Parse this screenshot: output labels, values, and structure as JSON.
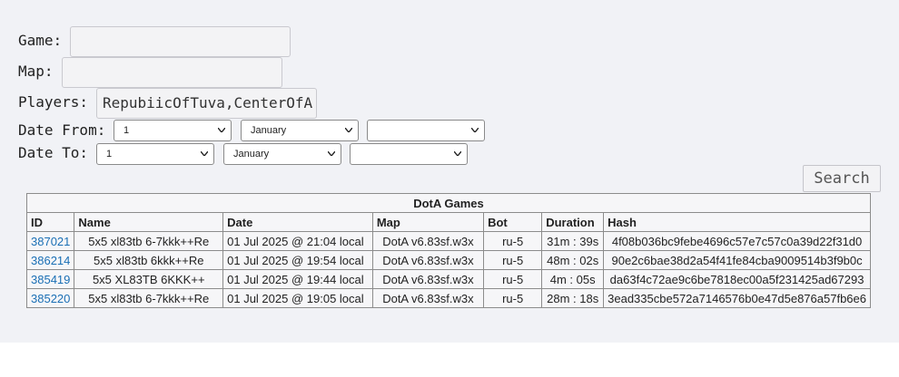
{
  "filters": {
    "game_label": "Game:",
    "game_value": "",
    "map_label": "Map:",
    "map_value": "",
    "players_label": "Players:",
    "players_value": "RepubiicOfTuva,CenterOfA",
    "date_from_label": "Date From:",
    "date_from_day": "1",
    "date_from_month": "January",
    "date_from_year": "",
    "date_to_label": "Date To:",
    "date_to_day": "1",
    "date_to_month": "January",
    "date_to_year": "",
    "search_label": "Search"
  },
  "table": {
    "title": "DotA Games",
    "headers": [
      "ID",
      "Name",
      "Date",
      "Map",
      "Bot",
      "Duration",
      "Hash"
    ],
    "rows": [
      {
        "id": "387021",
        "name": "5x5 xl83tb 6-7kkk++Re",
        "date": "01 Jul 2025 @ 21:04 local",
        "map": "DotA v6.83sf.w3x",
        "bot": "ru-5",
        "duration": "31m : 39s",
        "hash": "4f08b036bc9febe4696c57e7c57c0a39d22f31d0"
      },
      {
        "id": "386214",
        "name": "5x5 xl83tb 6kkk++Re",
        "date": "01 Jul 2025 @ 19:54 local",
        "map": "DotA v6.83sf.w3x",
        "bot": "ru-5",
        "duration": "48m : 02s",
        "hash": "90e2c6bae38d2a54f41fe84cba9009514b3f9b0c"
      },
      {
        "id": "385419",
        "name": "5x5 XL83TB 6KKK++",
        "date": "01 Jul 2025 @ 19:44 local",
        "map": "DotA v6.83sf.w3x",
        "bot": "ru-5",
        "duration": "4m : 05s",
        "hash": "da63f4c72ae9c6be7818ec00a5f231425ad67293"
      },
      {
        "id": "385220",
        "name": "5x5 xl83tb 6-7kkk++Re",
        "date": "01 Jul 2025 @ 19:05 local",
        "map": "DotA v6.83sf.w3x",
        "bot": "ru-5",
        "duration": "28m : 18s",
        "hash": "3ead335cbe572a7146576b0e47d5e876a57fb6e6"
      }
    ]
  }
}
